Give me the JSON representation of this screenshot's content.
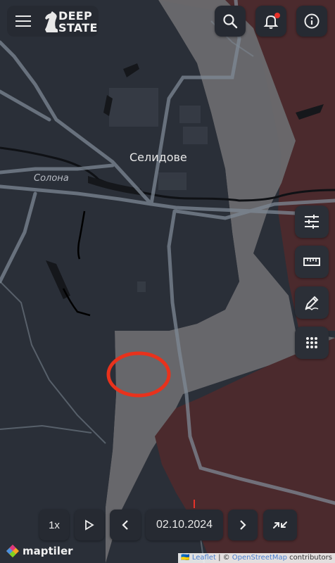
{
  "brand": {
    "name_line1": "DEEP",
    "name_line2": "STATE"
  },
  "map": {
    "city_label": "Селидове",
    "river_label": "Солона"
  },
  "toolbar": {
    "speed_label": "1x",
    "date": "02.10.2024"
  },
  "attribution": {
    "flag": "🇺🇦",
    "leaflet": "Leaflet",
    "separator": " | © ",
    "osm": "OpenStreetMap",
    "contributors": " contributors",
    "maptiler": "maptiler"
  },
  "colors": {
    "occupied": "#4b2a2d",
    "contested": "#6f6f72",
    "controlled": "#2a2f38",
    "roads": "#7d8894",
    "highlight": "#e8321c",
    "notification": "#e8322a"
  },
  "icons": {
    "menu": "menu-icon",
    "search": "search-icon",
    "notifications": "bell-icon",
    "info": "info-icon",
    "filters": "sliders-icon",
    "ruler": "ruler-icon",
    "draw": "pencil-icon",
    "apps": "grid-icon",
    "play": "play-icon",
    "prev": "chevron-left-icon",
    "next": "chevron-right-icon",
    "collapse": "collapse-icon"
  }
}
